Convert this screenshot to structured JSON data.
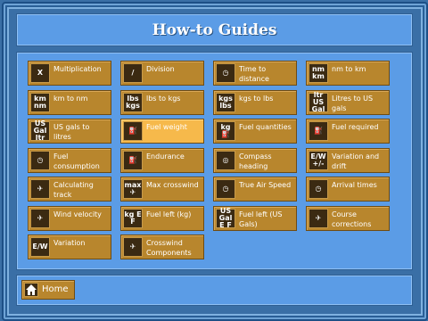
{
  "title": "How-to Guides",
  "home_label": "Home",
  "guides": [
    {
      "label": "Multiplication",
      "icon_text": "X",
      "icon": "multiply-icon"
    },
    {
      "label": "Division",
      "icon_text": "/",
      "icon": "divide-icon"
    },
    {
      "label": "Time to distance",
      "icon_text": "◷",
      "icon": "clock-icon"
    },
    {
      "label": "nm to km",
      "icon_text": "nm km",
      "icon": "nm-km-icon"
    },
    {
      "label": "km to nm",
      "icon_text": "km nm",
      "icon": "km-nm-icon"
    },
    {
      "label": "lbs to kgs",
      "icon_text": "lbs kgs",
      "icon": "lbs-kgs-icon"
    },
    {
      "label": "kgs to lbs",
      "icon_text": "kgs lbs",
      "icon": "kgs-lbs-icon"
    },
    {
      "label": "Litres to US gals",
      "icon_text": "ltr US Gal",
      "icon": "ltr-gal-icon"
    },
    {
      "label": "US gals to litres",
      "icon_text": "US Gal ltr",
      "icon": "gal-ltr-icon"
    },
    {
      "label": "Fuel weight",
      "icon_text": "⛽",
      "icon": "fuel-weight-icon"
    },
    {
      "label": "Fuel quantities",
      "icon_text": "kg ⛽",
      "icon": "fuel-quantities-icon"
    },
    {
      "label": "Fuel required",
      "icon_text": "⛽",
      "icon": "fuel-required-icon"
    },
    {
      "label": "Fuel consumption",
      "icon_text": "◷",
      "icon": "fuel-consumption-icon"
    },
    {
      "label": "Endurance",
      "icon_text": "⛽",
      "icon": "endurance-icon"
    },
    {
      "label": "Compass heading",
      "icon_text": "◎",
      "icon": "compass-icon"
    },
    {
      "label": "Variation and drift",
      "icon_text": "E/W +/-",
      "icon": "variation-drift-icon"
    },
    {
      "label": "Calculating track",
      "icon_text": "✈",
      "icon": "track-icon"
    },
    {
      "label": "Max crosswind",
      "icon_text": "max ✈",
      "icon": "crosswind-icon"
    },
    {
      "label": "True Air Speed",
      "icon_text": "◷",
      "icon": "airspeed-icon"
    },
    {
      "label": "Arrival times",
      "icon_text": "◷",
      "icon": "arrival-times-icon"
    },
    {
      "label": "Wind velocity",
      "icon_text": "✈",
      "icon": "wind-velocity-icon"
    },
    {
      "label": "Fuel left (kg)",
      "icon_text": "kg E F",
      "icon": "fuel-left-kg-icon"
    },
    {
      "label": "Fuel left (US Gals)",
      "icon_text": "US Gal E F",
      "icon": "fuel-left-gal-icon"
    },
    {
      "label": "Course corrections",
      "icon_text": "✈",
      "icon": "course-corrections-icon"
    },
    {
      "label": "Variation",
      "icon_text": "E/W",
      "icon": "variation-icon"
    },
    {
      "label": "Crosswind Components",
      "icon_text": "✈",
      "icon": "crosswind-components-icon"
    }
  ],
  "selected_index": 9,
  "colors": {
    "background": "#3a6fa6",
    "panel": "#5b9ce6",
    "tile": "#b8862d",
    "tile_selected": "#f6b94b",
    "icon_bg": "#3b2a12"
  }
}
